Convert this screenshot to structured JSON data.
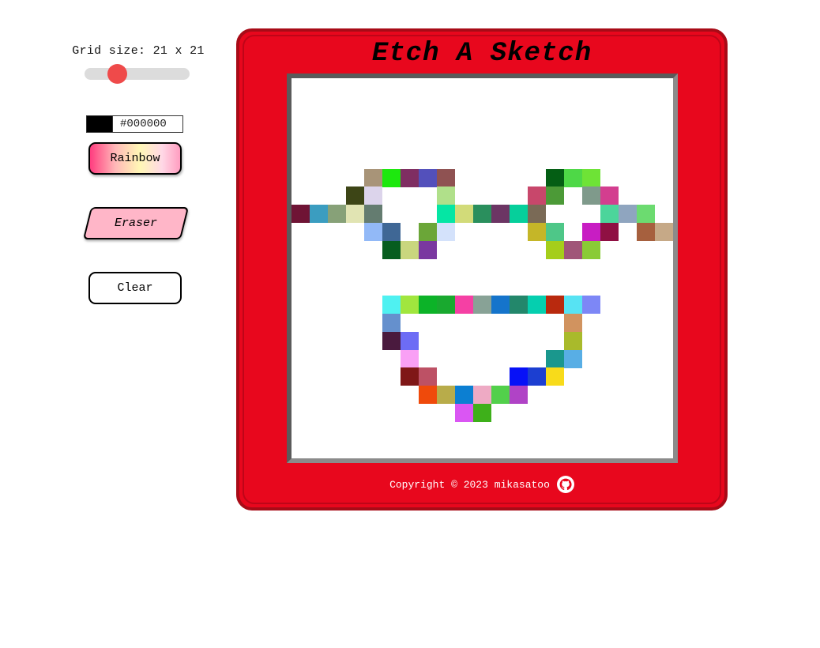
{
  "controls": {
    "grid_size_label": "Grid size: 21 x 21",
    "grid_size": 21,
    "slider_min": 1,
    "slider_max": 100,
    "color_value": "#000000",
    "rainbow_label": "Rainbow",
    "eraser_label": "Eraser",
    "clear_label": "Clear"
  },
  "frame": {
    "title": "Etch A Sketch",
    "footer_text": "Copyright © 2023 mikasatoo",
    "footer_icon": "github-icon"
  },
  "sketch": {
    "cols": 21,
    "rows": 21,
    "background": "#ffffff",
    "cells": [
      [
        5,
        4,
        "#a89478"
      ],
      [
        5,
        5,
        "#1de80e"
      ],
      [
        5,
        6,
        "#7f2e62"
      ],
      [
        5,
        7,
        "#5350bb"
      ],
      [
        5,
        8,
        "#8f5252"
      ],
      [
        5,
        14,
        "#045e14"
      ],
      [
        5,
        15,
        "#4ed847"
      ],
      [
        5,
        16,
        "#6ee336"
      ],
      [
        6,
        3,
        "#3d4516"
      ],
      [
        6,
        4,
        "#dcd4eb"
      ],
      [
        6,
        8,
        "#b0e08a"
      ],
      [
        6,
        13,
        "#c8476b"
      ],
      [
        6,
        14,
        "#4c9a37"
      ],
      [
        6,
        16,
        "#7f9a8b"
      ],
      [
        6,
        17,
        "#d33e8f"
      ],
      [
        7,
        0,
        "#6f1435"
      ],
      [
        7,
        1,
        "#3b9dc0"
      ],
      [
        7,
        2,
        "#87a178"
      ],
      [
        7,
        3,
        "#e1e4b3"
      ],
      [
        7,
        4,
        "#647c70"
      ],
      [
        7,
        8,
        "#05e6a4"
      ],
      [
        7,
        9,
        "#d2db79"
      ],
      [
        7,
        10,
        "#2a8f5d"
      ],
      [
        7,
        11,
        "#6c3564"
      ],
      [
        7,
        12,
        "#06cf9b"
      ],
      [
        7,
        13,
        "#7a6a56"
      ],
      [
        7,
        17,
        "#4cd59b"
      ],
      [
        7,
        18,
        "#8fa5bf"
      ],
      [
        7,
        19,
        "#6cdb70"
      ],
      [
        8,
        4,
        "#92b9f7"
      ],
      [
        8,
        5,
        "#3f6795"
      ],
      [
        8,
        7,
        "#6ba638"
      ],
      [
        8,
        8,
        "#d4e2fb"
      ],
      [
        8,
        13,
        "#c5b628"
      ],
      [
        8,
        14,
        "#4ec788"
      ],
      [
        8,
        16,
        "#c81dc3"
      ],
      [
        8,
        17,
        "#8f1043"
      ],
      [
        8,
        19,
        "#a6603e"
      ],
      [
        8,
        20,
        "#c6a987"
      ],
      [
        9,
        5,
        "#075d1f"
      ],
      [
        9,
        6,
        "#c9d67e"
      ],
      [
        9,
        7,
        "#7a38a0"
      ],
      [
        9,
        14,
        "#a5ce1a"
      ],
      [
        9,
        15,
        "#a05578"
      ],
      [
        9,
        16,
        "#8acb36"
      ],
      [
        12,
        5,
        "#4ff1f1"
      ],
      [
        12,
        6,
        "#a1e63e"
      ],
      [
        12,
        7,
        "#0cb328"
      ],
      [
        12,
        8,
        "#19a92f"
      ],
      [
        12,
        9,
        "#f540a4"
      ],
      [
        12,
        10,
        "#88a296"
      ],
      [
        12,
        11,
        "#1574cb"
      ],
      [
        12,
        12,
        "#23876b"
      ],
      [
        12,
        13,
        "#05cfaf"
      ],
      [
        12,
        14,
        "#b9290e"
      ],
      [
        12,
        15,
        "#57e3f3"
      ],
      [
        12,
        16,
        "#7d87f6"
      ],
      [
        13,
        5,
        "#6590cd"
      ],
      [
        13,
        15,
        "#d1935f"
      ],
      [
        14,
        5,
        "#4a1a3e"
      ],
      [
        14,
        6,
        "#6d6cf5"
      ],
      [
        14,
        15,
        "#a9ba2b"
      ],
      [
        15,
        6,
        "#f9a0f5"
      ],
      [
        15,
        14,
        "#1a978d"
      ],
      [
        15,
        15,
        "#58aee5"
      ],
      [
        16,
        6,
        "#7f1717"
      ],
      [
        16,
        7,
        "#bd5165"
      ],
      [
        16,
        12,
        "#0711f7"
      ],
      [
        16,
        13,
        "#1c3fd1"
      ],
      [
        16,
        14,
        "#f8db1a"
      ],
      [
        17,
        7,
        "#ef4a0b"
      ],
      [
        17,
        8,
        "#b8ac4a"
      ],
      [
        17,
        9,
        "#0c7fd2"
      ],
      [
        17,
        10,
        "#eeaac4"
      ],
      [
        17,
        11,
        "#52d04b"
      ],
      [
        17,
        12,
        "#b043c6"
      ],
      [
        18,
        9,
        "#da56f3"
      ],
      [
        18,
        10,
        "#3eb01a"
      ]
    ]
  }
}
